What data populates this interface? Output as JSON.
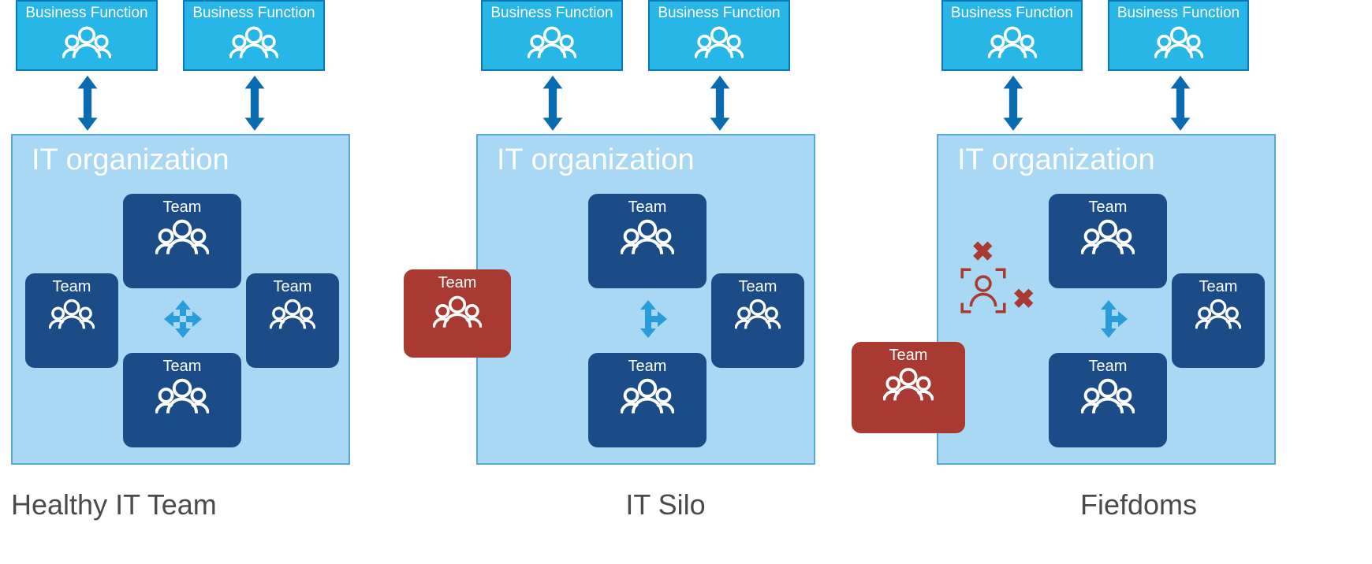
{
  "labels": {
    "business_function": "Business Function",
    "it_org": "IT organization",
    "team": "Team"
  },
  "columns": [
    {
      "caption": "Healthy IT Team",
      "variant": "healthy"
    },
    {
      "caption": "IT Silo",
      "variant": "silo"
    },
    {
      "caption": "Fiefdoms",
      "variant": "fiefdom"
    }
  ],
  "colors": {
    "bf_bg": "#27B6E5",
    "bf_border": "#0A7BB8",
    "org_bg": "#A9D8F5",
    "org_border": "#5AA8D8",
    "team_bg": "#1B4C87",
    "team_red": "#A83A32",
    "arrow": "#0A6BB0",
    "arrow_light": "#2B9CDB"
  }
}
